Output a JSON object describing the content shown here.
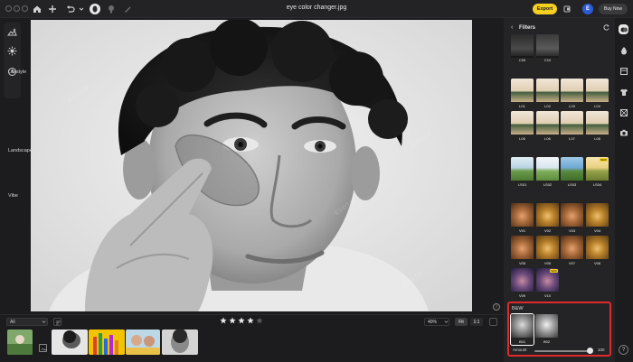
{
  "titlebar": {
    "title": "eye color changer.jpg",
    "export_label": "Export",
    "avatar_initial": "E",
    "buy_label": "Buy Now"
  },
  "canvas": {
    "watermark": "EVOTO"
  },
  "panel": {
    "header": "Filters",
    "top_thumbs": [
      "C09",
      "C10"
    ],
    "sections": {
      "lifestyle": {
        "title": "Lifestyle",
        "items": [
          "L01",
          "L02",
          "L03",
          "L04",
          "L05",
          "L06",
          "L07",
          "L08"
        ]
      },
      "landscape": {
        "title": "Landscape",
        "items": [
          "LS01",
          "LS02",
          "LS03",
          "LS04"
        ],
        "new_tag": "NEW"
      },
      "vibe": {
        "title": "Vibe",
        "items": [
          "V01",
          "V02",
          "V03",
          "V04",
          "V05",
          "V06",
          "V07",
          "V08",
          "V09",
          "V10"
        ],
        "new_tag": "NEW"
      },
      "bw": {
        "title": "B&W",
        "items": [
          "B01",
          "B02"
        ],
        "amount_label": "Amount",
        "amount_value": "100"
      }
    }
  },
  "bottombar": {
    "filter_value": "All",
    "zoom_value": "40%",
    "fit_label": "Fit",
    "one_to_one_label": "1:1",
    "rating": 4,
    "rating_max": 5
  },
  "help_label": "?",
  "info_label": "i",
  "colors": {
    "accent": "#f5d020",
    "highlight": "#e02a2a",
    "avatar": "#2d5bd8"
  }
}
